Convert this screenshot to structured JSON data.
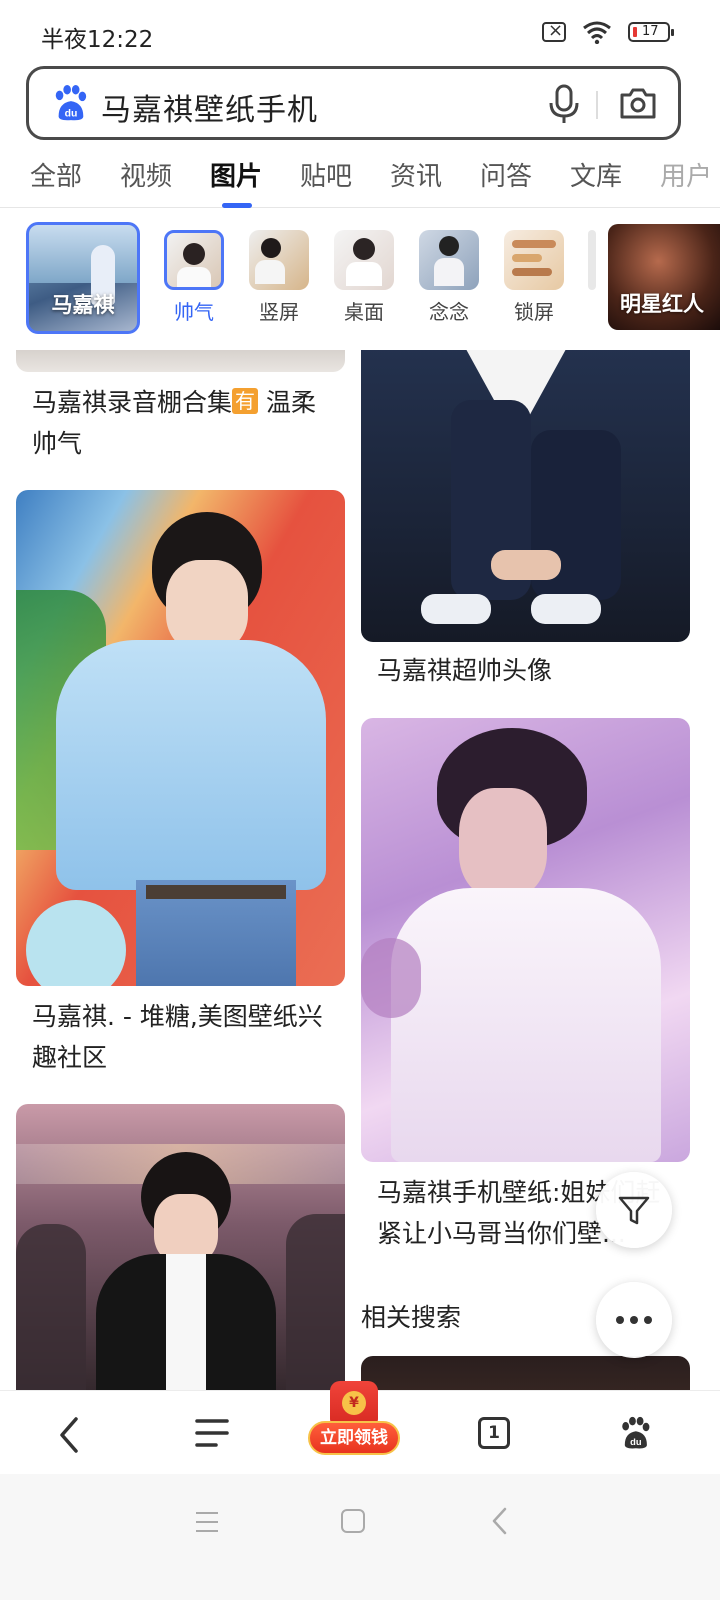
{
  "status_bar": {
    "time": "半夜12:22",
    "battery": "17"
  },
  "search": {
    "query": "马嘉祺壁纸手机"
  },
  "tabs": [
    {
      "label": "全部"
    },
    {
      "label": "视频"
    },
    {
      "label": "图片",
      "active": true
    },
    {
      "label": "贴吧"
    },
    {
      "label": "资讯"
    },
    {
      "label": "问答"
    },
    {
      "label": "文库"
    },
    {
      "label": "用户"
    }
  ],
  "chips": {
    "hero_left": "马嘉祺",
    "items": [
      {
        "label": "帅气",
        "selected": true
      },
      {
        "label": "竖屏"
      },
      {
        "label": "桌面"
      },
      {
        "label": "念念"
      },
      {
        "label": "锁屏"
      }
    ],
    "hero_right": "明星红人"
  },
  "feed": {
    "left": [
      {
        "caption_pre": "马嘉祺录音棚合集",
        "tag": "有",
        "caption_post": " 温柔帅气"
      },
      {
        "caption": "马嘉祺. - 堆糖,美图壁纸兴趣社区"
      },
      {
        "caption": ""
      }
    ],
    "right": [
      {
        "caption": "马嘉祺超帅头像"
      },
      {
        "caption": "马嘉祺手机壁纸:姐妹们赶紧让小马哥当你们壁..."
      }
    ],
    "related_title": "相关搜索"
  },
  "toolbar": {
    "promo_label": "立即领钱",
    "promo_coin": "¥",
    "tab_count": "1"
  },
  "colors": {
    "accent": "#3465f5",
    "promo_red": "#e8331f",
    "promo_gold": "#f7c248"
  }
}
